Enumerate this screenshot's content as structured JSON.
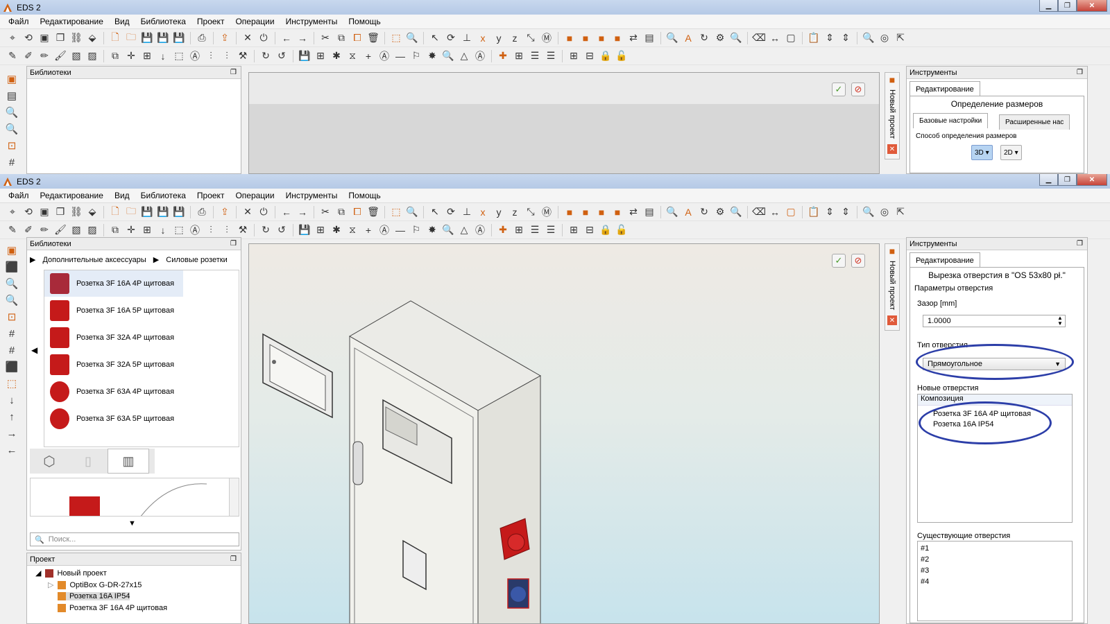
{
  "app": {
    "title": "EDS 2"
  },
  "menu": [
    "Файл",
    "Редактирование",
    "Вид",
    "Библиотека",
    "Проект",
    "Операции",
    "Инструменты",
    "Помощь"
  ],
  "window1": {
    "libraries_title": "Библиотеки",
    "tools_title": "Инструменты",
    "editing_tab": "Редактирование",
    "section_title": "Определение размеров",
    "tab_basic": "Базовые настройки",
    "tab_advanced": "Расширенные нас",
    "method_label": "Способ определения размеров",
    "btn_3d": "3D",
    "btn_2d": "2D",
    "vertical_tab": "Новый проект"
  },
  "window2": {
    "libraries_title": "Библиотеки",
    "crumb1": "Дополнительные аксессуары",
    "crumb2": "Силовые розетки",
    "library_items": [
      "Розетка 3F 16A 4P щитовая",
      "Розетка 3F 16A 5P щитовая",
      "Розетка 3F 32A 4P щитовая",
      "Розетка 3F 32A 5P щитовая",
      "Розетка 3F 63A 4P щитовая",
      "Розетка 3F 63A 5P щитовая"
    ],
    "search_placeholder": "Поиск...",
    "project_title": "Проект",
    "project_tree": {
      "root": "Новый проект",
      "items": [
        "OptiBox G-DR-27x15",
        "Розетка 16A IP54",
        "Розетка 3F 16A 4P щитовая"
      ]
    },
    "vertical_tab": "Новый проект",
    "tools_title": "Инструменты",
    "editing_tab": "Редактирование",
    "section_title": "Вырезка отверстия в \"OS 53x80 pł.\"",
    "params_label": "Параметры отверстия",
    "gap_label": "Зазор [mm]",
    "gap_value": "1.0000",
    "type_label": "Тип отверстия",
    "type_value": "Прямоугольное",
    "new_holes_label": "Новые отверстия",
    "new_holes_header": "Композиция",
    "new_holes": [
      "Розетка 3F 16A 4P щитовая",
      "Розетка 16A IP54"
    ],
    "existing_label": "Существующие отверстия",
    "existing_holes": [
      "#1",
      "#2",
      "#3",
      "#4"
    ]
  },
  "colors": {
    "accent_oval": "#2c3ea8",
    "socket_red": "#c51a1a",
    "title_bar": "#b5c9e6"
  }
}
